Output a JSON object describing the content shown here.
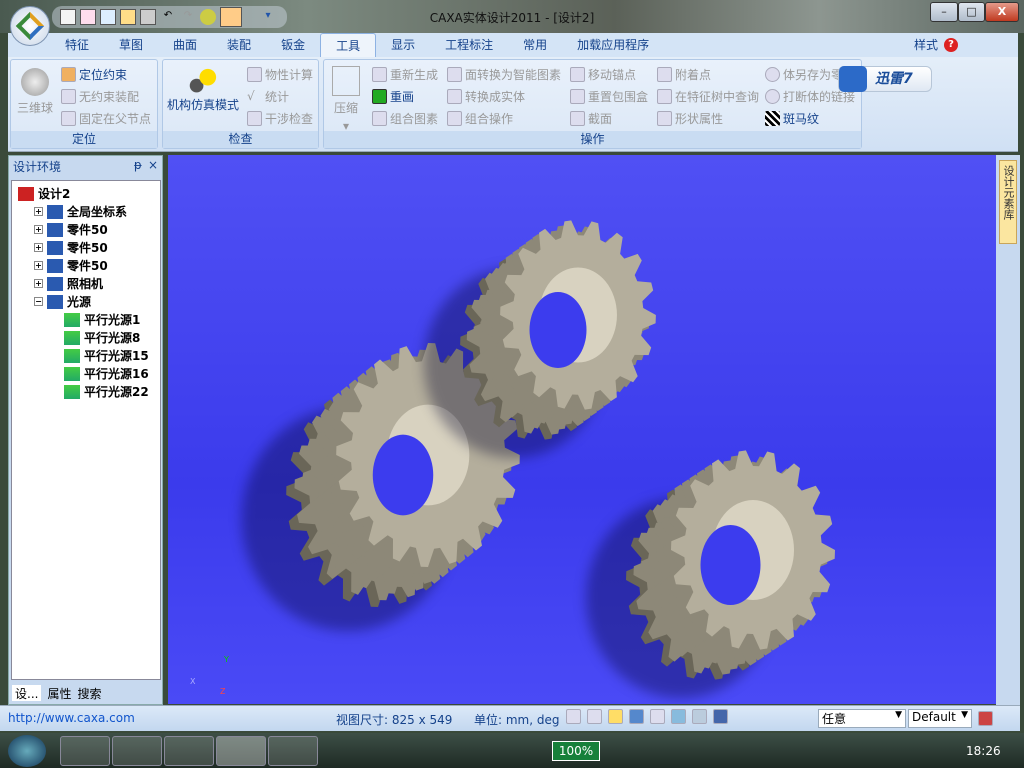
{
  "window": {
    "title": "CAXA实体设计2011 - [设计2]",
    "min": "–",
    "max": "□",
    "close": "X"
  },
  "quick_access": [
    "new",
    "open-design",
    "preview",
    "open-folder",
    "save",
    "undo",
    "redo",
    "gear-tool",
    "tree-tool",
    "dropdown"
  ],
  "tabs": [
    {
      "label": "特征"
    },
    {
      "label": "草图"
    },
    {
      "label": "曲面"
    },
    {
      "label": "装配"
    },
    {
      "label": "钣金"
    },
    {
      "label": "工具",
      "active": true
    },
    {
      "label": "显示"
    },
    {
      "label": "工程标注"
    },
    {
      "label": "常用"
    },
    {
      "label": "加载应用程序"
    }
  ],
  "tabs_right": {
    "style": "样式",
    "help": "?"
  },
  "ribbon": {
    "groups": {
      "locate": "定位",
      "inspect": "检查",
      "operate": "操作"
    },
    "locate": {
      "ball": "三维球",
      "constraint": "定位约束",
      "free": "无约束装配",
      "fix": "固定在父节点"
    },
    "inspect": {
      "sim": "机构仿真模式",
      "mass": "物性计算",
      "stats": "统计",
      "interf": "干涉检查"
    },
    "operate": {
      "compress": "压缩",
      "regen": "重新生成",
      "redraw": "重画",
      "combine": "组合图素",
      "smart": "面转换为智能图素",
      "tosolid": "转换成实体",
      "combop": "组合操作",
      "anchor": "移动锚点",
      "bbox": "重置包围盒",
      "section": "截面",
      "attach": "附着点",
      "findtree": "在特征树中查询",
      "shape": "形状属性",
      "saveas": "体另存为零件",
      "breaklink": "打断体的链接",
      "zebra": "斑马纹"
    }
  },
  "xunlei": "迅雷7",
  "panel": {
    "title": "设计环境",
    "pin": "ᵖ",
    "close": "×",
    "tree": [
      {
        "label": "设计2",
        "level": 0
      },
      {
        "label": "全局坐标系",
        "level": 1,
        "exp": "+"
      },
      {
        "label": "零件50",
        "level": 1,
        "exp": "+"
      },
      {
        "label": "零件50",
        "level": 1,
        "exp": "+"
      },
      {
        "label": "零件50",
        "level": 1,
        "exp": "+"
      },
      {
        "label": "照相机",
        "level": 1,
        "exp": "+"
      },
      {
        "label": "光源",
        "level": 1,
        "exp": "−"
      },
      {
        "label": "平行光源1",
        "level": 2
      },
      {
        "label": "平行光源8",
        "level": 2
      },
      {
        "label": "平行光源15",
        "level": 2
      },
      {
        "label": "平行光源16",
        "level": 2
      },
      {
        "label": "平行光源22",
        "level": 2
      }
    ],
    "bottom_tabs": [
      "设...",
      "属性",
      "搜索"
    ]
  },
  "right_tab": "设计元素库",
  "viewport": {
    "bg": "#4040f0",
    "axes": {
      "x": "X",
      "y": "Y",
      "z": "Z"
    }
  },
  "status": {
    "link": "http://www.caxa.com",
    "view_size": "视图尺寸: 825 x 549",
    "units": "单位: mm, deg",
    "filter": "任意",
    "style": "Default"
  },
  "taskbar": {
    "battery": "100%",
    "time": "18:26"
  }
}
